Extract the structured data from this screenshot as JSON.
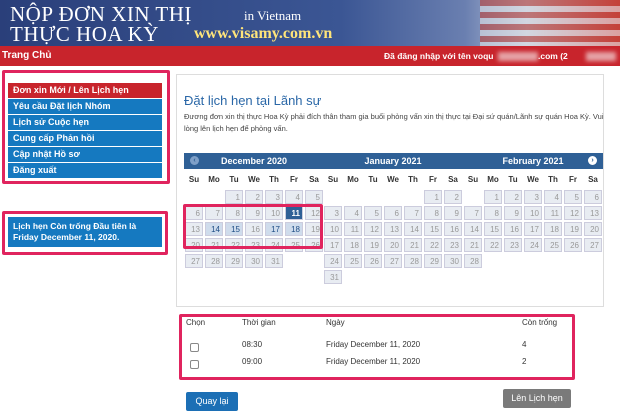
{
  "banner": {
    "line1": "NỘP ĐƠN XIN THỊ",
    "line2": "THỰC HOA KỲ",
    "country": "in  Vietnam",
    "url": "www.visamy.com.vn"
  },
  "nav": {
    "home": "Trang Chủ",
    "login_text": "Đã đăng nhập với tên  voqu",
    "email_tail": ".com (2"
  },
  "menu": {
    "items": [
      "Đơn xin Mới / Lên Lịch hẹn",
      "Yêu cầu Đặt lịch Nhóm",
      "Lịch sử Cuộc hẹn",
      "Cung cấp Phản hồi",
      "Cập nhật Hồ sơ",
      "Đăng xuất"
    ]
  },
  "info": {
    "line1": "Lịch hẹn Còn trống Đầu tiên là",
    "line2": "Friday December 11, 2020."
  },
  "content": {
    "title": "Đặt lịch hẹn tại Lãnh sự",
    "desc": "Đương đơn xin thị thực Hoa Kỳ phải đích thân tham gia buổi phỏng vấn xin thị thực tại Đại sứ quán/Lãnh sự quán Hoa Kỳ. Vui lòng lên lịch hẹn để phỏng vấn."
  },
  "dow": [
    "Su",
    "Mo",
    "Tu",
    "We",
    "Th",
    "Fr",
    "Sa"
  ],
  "calendars": [
    {
      "title": "December 2020",
      "offset": 2,
      "days": 31,
      "available": [
        14,
        15,
        17,
        18
      ],
      "selected": 11,
      "grey_after": 18
    },
    {
      "title": "January 2021",
      "offset": 5,
      "days": 31,
      "available": [],
      "selected": null,
      "grey_after": null
    },
    {
      "title": "February 2021",
      "offset": 1,
      "days": 28,
      "available": [],
      "selected": null,
      "grey_after": null
    }
  ],
  "slots": {
    "headers": {
      "choose": "Chọn",
      "time": "Thời gian",
      "date": "Ngày",
      "remaining": "Còn trống"
    },
    "rows": [
      {
        "time": "08:30",
        "date": "Friday December 11, 2020",
        "remaining": "4"
      },
      {
        "time": "09:00",
        "date": "Friday December 11, 2020",
        "remaining": "2"
      }
    ]
  },
  "buttons": {
    "back": "Quay lại",
    "book": "Lên Lịch hẹn"
  },
  "colors": {
    "accent": "#c8242c",
    "primary": "#1579c0",
    "highlight": "#e0245e"
  }
}
